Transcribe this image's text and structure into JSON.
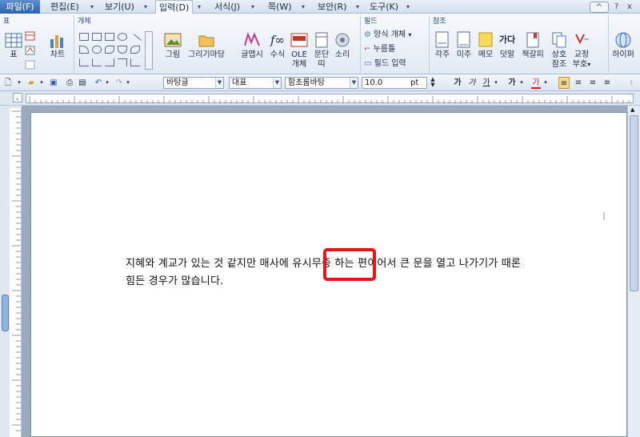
{
  "menu": {
    "file": "파일(F)",
    "items": [
      "편집(E)",
      "보기(U)",
      "입력(D)",
      "서식(J)",
      "쪽(W)",
      "보안(R)",
      "도구(K)"
    ],
    "active": "입력(D)",
    "window_controls": [
      "^",
      "?",
      "x"
    ]
  },
  "ribbon": {
    "groups": {
      "table": "표",
      "object": "개체",
      "field": "필드",
      "reference": "참조"
    },
    "buttons": {
      "table": "표",
      "chart": "차트",
      "picture": "그림",
      "draw_wizard": "그리기마당",
      "glyph": "글맵시",
      "formula": "수식",
      "ole": "OLE",
      "ole_sub": "개체",
      "para": "문단",
      "para_sub": "띠",
      "sound": "소리",
      "form_object": "양식 개체",
      "press": "누름틀",
      "field_input": "필드 입력",
      "footnote": "각주",
      "endnote": "미주",
      "memo": "메모",
      "hanja": "가다",
      "overlay": "덧말",
      "bookmark": "책갈피",
      "cross_ref": "상호",
      "cross_ref_sub": "참조",
      "proof": "교정",
      "proof_sub": "부호",
      "hyperlink": "하이퍼"
    }
  },
  "format": {
    "style": "바탕글",
    "layout": "대표",
    "font": "함초롬바탕",
    "size": "10.0",
    "unit": "pt",
    "bold": "가",
    "italic": "가",
    "underline": "가",
    "strike": "가",
    "color": "가"
  },
  "document": {
    "text_before": "지혜와 계교가 있는 것 같지만 매사에 ",
    "highlight": "유시무종",
    "text_after": " 하는 편이어서 큰 문을 열고 나가기가 때론",
    "line2": "힘든 경우가 많습니다."
  },
  "colors": {
    "highlight_border": "#e6141b",
    "accent": "#2f62ad"
  }
}
